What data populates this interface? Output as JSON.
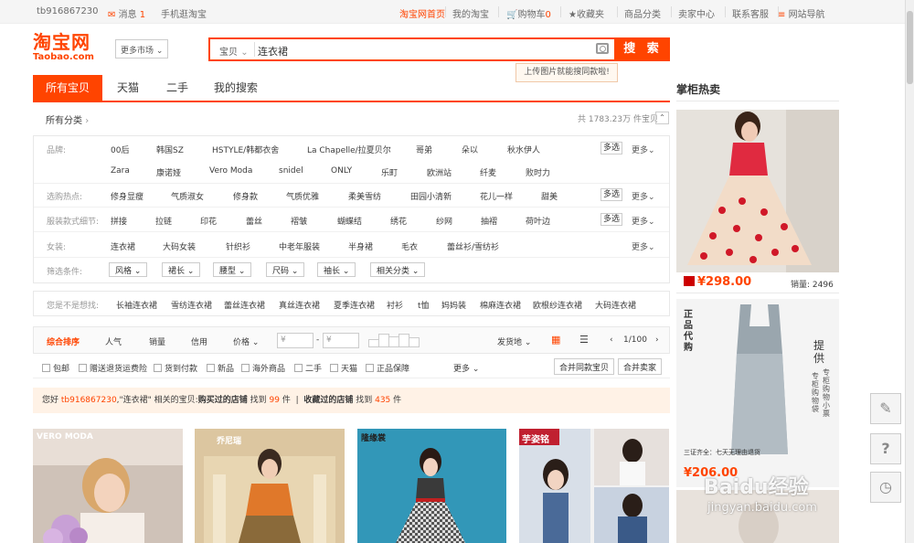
{
  "topbar": {
    "user": "tb916867230",
    "messages_label": "消息",
    "messages_count": "1",
    "mobile": "手机逛淘宝",
    "home": "淘宝网首页",
    "my_taobao": "我的淘宝",
    "cart_label": "购物车",
    "cart_count": "0",
    "favorites": "收藏夹",
    "categories": "商品分类",
    "seller_center": "卖家中心",
    "service": "联系客服",
    "site_nav": "网站导航"
  },
  "logo": {
    "cn": "淘宝网",
    "en": "Taobao.com"
  },
  "market": "更多市场",
  "search": {
    "category": "宝贝",
    "query": "连衣裙",
    "button": "搜 索",
    "tooltip": "上传图片就能搜同款啦!"
  },
  "tabs": [
    "所有宝贝",
    "天猫",
    "二手",
    "我的搜索"
  ],
  "breadcrumb": "所有分类",
  "result_count": "共 1783.23万 件宝贝",
  "filters": {
    "brand_label": "品牌:",
    "brands_row1": [
      "00后",
      "韩国SZ",
      "HSTYLE/韩都衣舍",
      "La Chapelle/拉夏贝尔",
      "哥弟",
      "朵以",
      "秋水伊人"
    ],
    "brands_row2": [
      "Zara",
      "康诺娅",
      "Vero Moda",
      "snidel",
      "ONLY",
      "乐町",
      "欧洲站",
      "纤麦",
      "败时力"
    ],
    "hot_label": "选购热点:",
    "hot": [
      "修身显瘦",
      "气质淑女",
      "修身款",
      "气质优雅",
      "柔美雪纺",
      "田园小清新",
      "花儿一样",
      "甜美"
    ],
    "detail_label": "服装款式细节:",
    "details": [
      "拼接",
      "拉链",
      "印花",
      "蕾丝",
      "褶皱",
      "蝴蝶结",
      "绣花",
      "纱网",
      "抽褶",
      "荷叶边"
    ],
    "women_label": "女装:",
    "women": [
      "连衣裙",
      "大码女装",
      "针织衫",
      "中老年服装",
      "半身裙",
      "毛衣",
      "蕾丝衫/雪纺衫"
    ],
    "cond_label": "筛选条件:",
    "conds": [
      "风格",
      "裙长",
      "腰型",
      "尺码",
      "袖长",
      "相关分类"
    ],
    "multi": "多选",
    "more": "更多"
  },
  "related": {
    "label": "您是不是想找:",
    "items": [
      "长袖连衣裙",
      "雪纺连衣裙",
      "蕾丝连衣裙",
      "真丝连衣裙",
      "夏季连衣裙",
      "衬衫",
      "t恤",
      "妈妈装",
      "棉麻连衣裙",
      "欧根纱连衣裙",
      "大码连衣裙"
    ]
  },
  "sort": {
    "items": [
      "综合排序",
      "人气",
      "销量",
      "信用",
      "价格"
    ],
    "price_from": "¥",
    "price_to": "¥",
    "ship_from": "发货地",
    "page": "1/100"
  },
  "options": {
    "items": [
      "包邮",
      "赠送退货运费险",
      "货到付款",
      "新品",
      "海外商品",
      "二手",
      "天猫",
      "正品保障"
    ],
    "more": "更多",
    "merge_same": "合并同款宝贝",
    "merge_seller": "合并卖家"
  },
  "notice": {
    "prefix": "您好",
    "user": "tb916867230",
    "mid": ",\"连衣裙\" 相关的宝贝:",
    "bought": "购买过的店铺",
    "found1": "找到",
    "n1": "99",
    "unit1": "件",
    "fav": "收藏过的店铺",
    "found2": "找到",
    "n2": "435",
    "unit2": "件"
  },
  "products": [
    {
      "brand": "VERO MODA"
    },
    {
      "brand": "乔尼瑞"
    },
    {
      "brand": "隆缘裳"
    },
    {
      "brand": "芋姿铭"
    }
  ],
  "sidebar": {
    "title": "掌柜热卖",
    "item1_price": "¥298.00",
    "item1_sold": "销量: 2496",
    "item2_text1": "正品代购",
    "item2_text2": "提供",
    "item2_text3": "专柜购物小票",
    "item2_text4": "专柜购物袋",
    "item2_text5": "三证齐全：七天无理由退货",
    "item2_price": "¥206.00"
  },
  "tools": [
    "✎",
    "?",
    "◷"
  ],
  "watermark": {
    "text": "Baidu经验",
    "url": "jingyan.baidu.com"
  }
}
